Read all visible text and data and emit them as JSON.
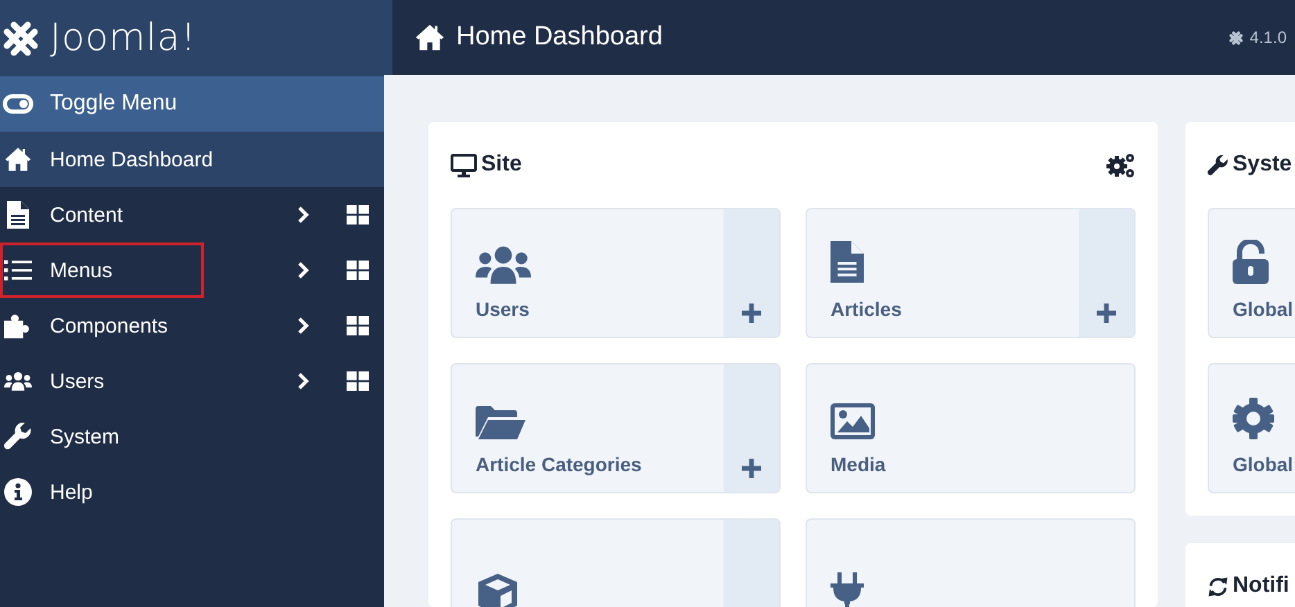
{
  "sidebar": {
    "logo": "Joomla!",
    "toggle": {
      "label": "Toggle Menu"
    },
    "items": [
      {
        "label": "Home Dashboard",
        "selected": true,
        "expandable": false,
        "highlighted": false
      },
      {
        "label": "Content",
        "selected": false,
        "expandable": true,
        "highlighted": false
      },
      {
        "label": "Menus",
        "selected": false,
        "expandable": true,
        "highlighted": true
      },
      {
        "label": "Components",
        "selected": false,
        "expandable": true,
        "highlighted": false
      },
      {
        "label": "Users",
        "selected": false,
        "expandable": true,
        "highlighted": false
      },
      {
        "label": "System",
        "selected": false,
        "expandable": false,
        "highlighted": false
      },
      {
        "label": "Help",
        "selected": false,
        "expandable": false,
        "highlighted": false
      }
    ]
  },
  "header": {
    "title": "Home Dashboard",
    "version": "4.1.0"
  },
  "cards": [
    {
      "title": "Site",
      "kind": "site",
      "tiles": [
        {
          "label": "Users",
          "add": true
        },
        {
          "label": "Articles",
          "add": true
        },
        {
          "label": "Article Categories",
          "add": true
        },
        {
          "label": "Media",
          "add": false
        },
        {
          "add": true
        },
        {
          "add": false
        }
      ]
    },
    {
      "title": "Syste",
      "kind": "system",
      "tiles": [
        {
          "label": "Global"
        },
        {
          "label": "Global"
        }
      ]
    },
    {
      "title": "Notifi",
      "kind": "notifications"
    }
  ]
}
